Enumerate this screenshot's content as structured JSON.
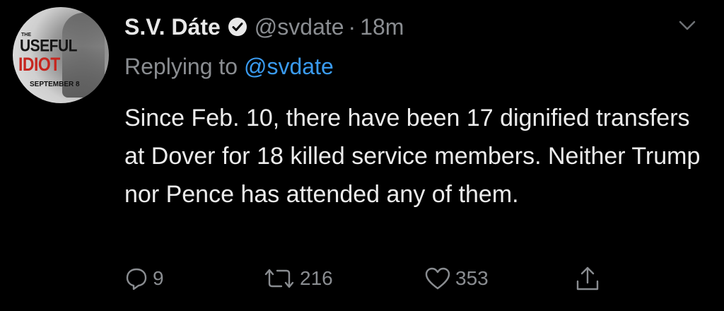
{
  "author": {
    "name": "S.V. Dáte",
    "handle": "@svdate",
    "separator": "·",
    "time": "18m",
    "verified": true,
    "avatar": {
      "top_small": "THE",
      "line1": "USEFUL",
      "line2": "IDIOT",
      "line3": "SEPTEMBER 8"
    }
  },
  "reply": {
    "prefix": "Replying to",
    "mention": "@svdate"
  },
  "tweet": {
    "text": "Since Feb. 10, there have been 17 dignified transfers at Dover for 18 killed service members. Neither Trump nor Pence has attended any of them."
  },
  "actions": {
    "reply_count": "9",
    "retweet_count": "216",
    "like_count": "353"
  },
  "colors": {
    "background": "#000000",
    "text": "#ececec",
    "muted": "#8a8d91",
    "link": "#3a9bf0"
  }
}
